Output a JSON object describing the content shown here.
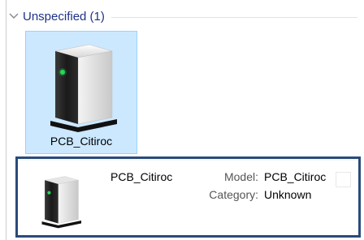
{
  "group": {
    "title": "Unspecified (1)",
    "chevron_icon": "chevron-down-icon"
  },
  "device_tile": {
    "icon": "device-tower-icon",
    "label": "PCB_Citiroc"
  },
  "details_pane": {
    "icon": "device-tower-icon",
    "name": "PCB_Citiroc",
    "properties": [
      {
        "label": "Model:",
        "value": "PCB_Citiroc"
      },
      {
        "label": "Category:",
        "value": "Unknown"
      }
    ]
  },
  "colors": {
    "group_title": "#1e3287",
    "selection_fill": "#cce8ff",
    "selection_border": "#99d1ff",
    "details_border": "#2a4a7a",
    "power_led": "#22dd55"
  }
}
